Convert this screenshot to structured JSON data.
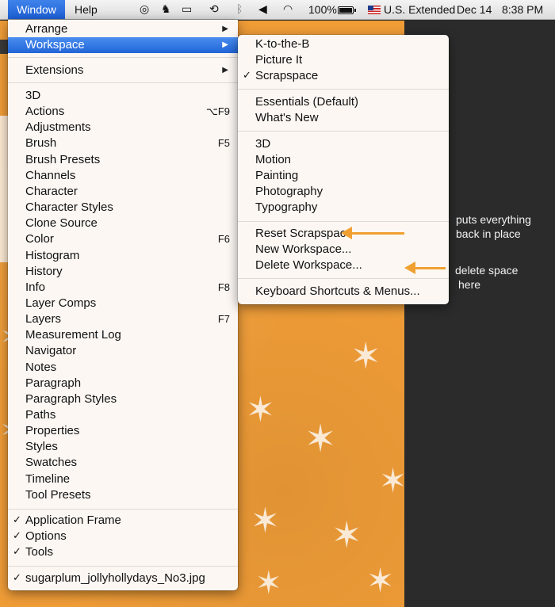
{
  "menubar": {
    "window": "Window",
    "help": "Help",
    "battery": "100%",
    "input_source": "U.S. Extended",
    "date": "Dec 14",
    "time": "8:38 PM"
  },
  "window_menu": {
    "top_items": [
      {
        "label": "Arrange"
      },
      {
        "label": "Workspace"
      }
    ],
    "extensions": "Extensions",
    "panels": [
      {
        "label": "3D",
        "shortcut": ""
      },
      {
        "label": "Actions",
        "shortcut": "⌥F9"
      },
      {
        "label": "Adjustments",
        "shortcut": ""
      },
      {
        "label": "Brush",
        "shortcut": "F5"
      },
      {
        "label": "Brush Presets",
        "shortcut": ""
      },
      {
        "label": "Channels",
        "shortcut": ""
      },
      {
        "label": "Character",
        "shortcut": ""
      },
      {
        "label": "Character Styles",
        "shortcut": ""
      },
      {
        "label": "Clone Source",
        "shortcut": ""
      },
      {
        "label": "Color",
        "shortcut": "F6"
      },
      {
        "label": "Histogram",
        "shortcut": ""
      },
      {
        "label": "History",
        "shortcut": ""
      },
      {
        "label": "Info",
        "shortcut": "F8"
      },
      {
        "label": "Layer Comps",
        "shortcut": ""
      },
      {
        "label": "Layers",
        "shortcut": "F7"
      },
      {
        "label": "Measurement Log",
        "shortcut": ""
      },
      {
        "label": "Navigator",
        "shortcut": ""
      },
      {
        "label": "Notes",
        "shortcut": ""
      },
      {
        "label": "Paragraph",
        "shortcut": ""
      },
      {
        "label": "Paragraph Styles",
        "shortcut": ""
      },
      {
        "label": "Paths",
        "shortcut": ""
      },
      {
        "label": "Properties",
        "shortcut": ""
      },
      {
        "label": "Styles",
        "shortcut": ""
      },
      {
        "label": "Swatches",
        "shortcut": ""
      },
      {
        "label": "Timeline",
        "shortcut": ""
      },
      {
        "label": "Tool Presets",
        "shortcut": ""
      }
    ],
    "view_items": [
      {
        "label": "Application Frame"
      },
      {
        "label": "Options"
      },
      {
        "label": "Tools"
      }
    ],
    "document": "sugarplum_jollyhollydays_No3.jpg"
  },
  "workspace_menu": {
    "custom": [
      {
        "label": "K-to-the-B"
      },
      {
        "label": "Picture It"
      },
      {
        "label": "Scrapspace"
      }
    ],
    "defaults": [
      {
        "label": "Essentials (Default)"
      },
      {
        "label": "What's New"
      }
    ],
    "presets": [
      {
        "label": "3D"
      },
      {
        "label": "Motion"
      },
      {
        "label": "Painting"
      },
      {
        "label": "Photography"
      },
      {
        "label": "Typography"
      }
    ],
    "manage": [
      {
        "label": "Reset Scrapspace"
      },
      {
        "label": "New Workspace..."
      },
      {
        "label": "Delete Workspace..."
      }
    ],
    "shortcuts": "Keyboard Shortcuts & Menus..."
  },
  "annotations": {
    "reset_note_line1": "puts everything",
    "reset_note_line2": "back in place",
    "delete_note_line1": "delete space",
    "delete_note_line2": "here"
  },
  "colors": {
    "menu_bg": "#fcf7f3",
    "highlight": "#2a6fde",
    "canvas": "#ef9c37",
    "annotation_arrow": "#f0a030"
  }
}
